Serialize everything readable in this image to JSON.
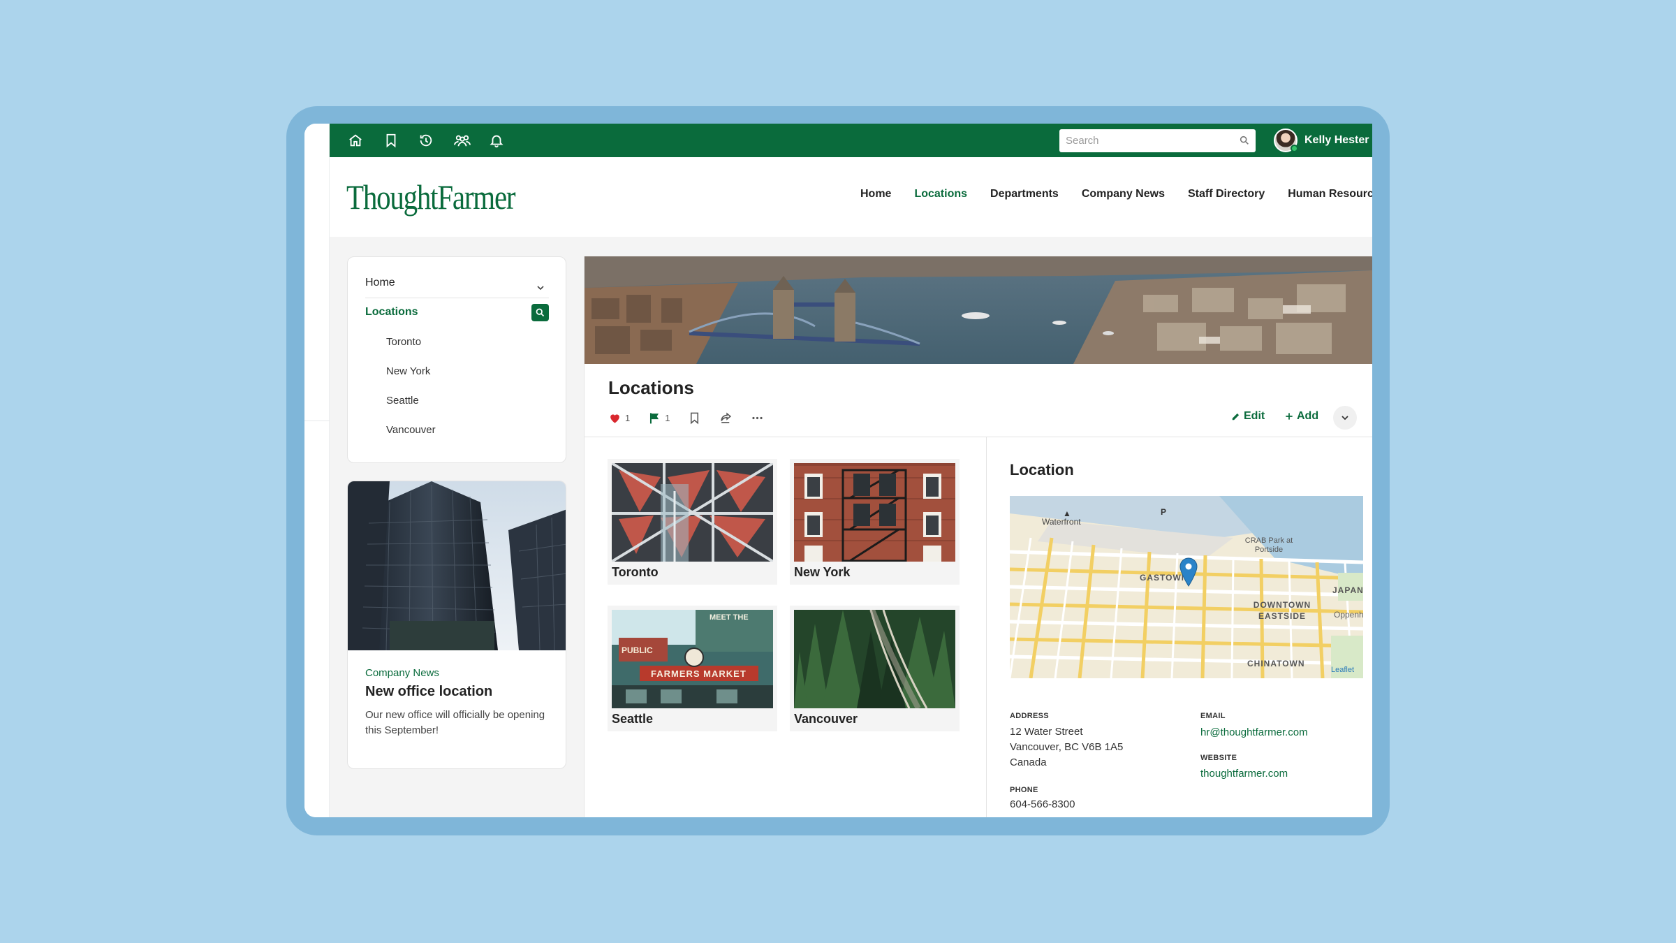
{
  "topbar": {
    "icons": [
      "home-icon",
      "bookmark-icon",
      "history-icon",
      "people-icon",
      "bell-icon"
    ],
    "search_placeholder": "Search",
    "user_name": "Kelly Hester"
  },
  "header": {
    "logo": "ThoughtFarmer",
    "nav": [
      "Home",
      "Locations",
      "Departments",
      "Company News",
      "Staff Directory",
      "Human Resources"
    ],
    "active_nav": "Locations"
  },
  "sidebar": {
    "home": "Home",
    "locations": "Locations",
    "children": [
      "Toronto",
      "New York",
      "Seattle",
      "Vancouver"
    ]
  },
  "news": {
    "category": "Company News",
    "title": "New office location",
    "body": "Our new office will officially be opening this September!"
  },
  "page": {
    "title": "Locations",
    "like_count": "1",
    "flag_count": "1",
    "edit_label": "Edit",
    "add_label": "Add"
  },
  "tiles": [
    "Toronto",
    "New York",
    "Seattle",
    "Vancouver"
  ],
  "location": {
    "heading": "Location",
    "address_label": "ADDRESS",
    "address_lines": [
      "12 Water Street",
      "Vancouver, BC V6B 1A5",
      "Canada"
    ],
    "phone_label": "PHONE",
    "phone": "604-566-8300",
    "email_label": "EMAIL",
    "email": "hr@thoughtfarmer.com",
    "website_label": "WEBSITE",
    "website": "thoughtfarmer.com",
    "map_labels": {
      "waterfront": "Waterfront",
      "crab_park": "CRAB Park at Portside",
      "gastown": "GASTOWN",
      "downtown": "DOWNTOWN EASTSIDE",
      "japantown": "JAPANTOWN",
      "oppenheimer": "Oppenheimer",
      "chinatown": "CHINATOWN",
      "parking": "P",
      "attribution": "Leaflet"
    }
  },
  "colors": {
    "brand_green": "#0a6b3c",
    "background": "#acd4ec",
    "frame": "#7fb6d9"
  }
}
